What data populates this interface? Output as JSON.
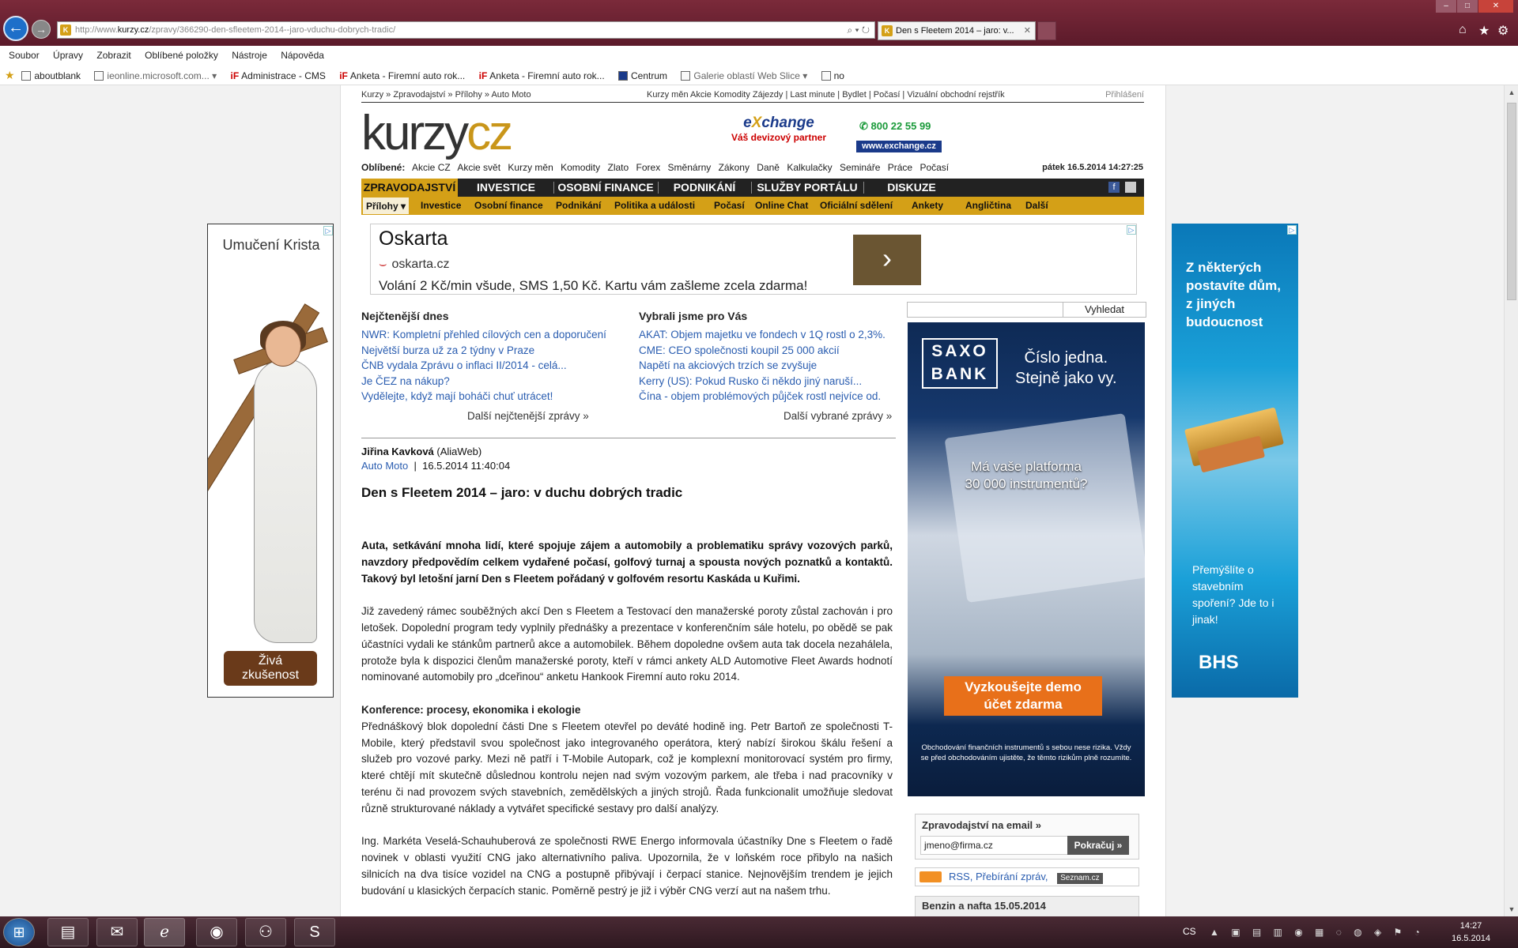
{
  "browser": {
    "url_prefix": "http://www.",
    "url_domain": "kurzy.cz",
    "url_path": "/zpravy/366290-den-sfleetem-2014--jaro-vduchu-dobrych-tradic/",
    "tab_title": "Den s Fleetem 2014 – jaro: v...",
    "tab_close": "✕",
    "favicon": "K",
    "back": "←",
    "forward": "→",
    "addr_icons": "⌕ ▾ ↻",
    "win_min": "–",
    "win_max": "□",
    "win_close": "✕",
    "home": "⌂",
    "star": "★",
    "gear": "⚙"
  },
  "menubar": [
    "Soubor",
    "Úpravy",
    "Zobrazit",
    "Oblíbené položky",
    "Nástroje",
    "Nápověda"
  ],
  "favorites": {
    "star": "★",
    "items": [
      "aboutblank",
      "ieonline.microsoft.com... ▾",
      "Administrace - CMS",
      "Anketa - Firemní auto rok...",
      "Anketa - Firemní auto rok...",
      "Centrum",
      "Galerie oblastí Web Slice ▾",
      "no"
    ]
  },
  "site": {
    "breadcrumb": "Kurzy » Zpravodajství » Přílohy » Auto Moto",
    "toplinks": "Kurzy měn Akcie Komodity Zájezdy | Last minute | Bydlet | Počasí | Vizuální obchodní rejstřík",
    "login": "Přihlášení",
    "logo_k": "kurzy",
    "logo_cz": "cz",
    "exchange_e": "e",
    "exchange_x": "X",
    "exchange_rest": "change",
    "exchange_sub": "Váš devizový partner",
    "phone": "✆ 800 22 55 99",
    "exchange_url": "www.exchange.cz",
    "oblibene_label": "Oblíbené:",
    "oblibene": [
      "Akcie CZ",
      "Akcie svět",
      "Kurzy měn",
      "Komodity",
      "Zlato",
      "Forex",
      "Směnárny",
      "Zákony",
      "Daně",
      "Kalkulačky",
      "Semináře",
      "Práce",
      "Počasí"
    ],
    "datetime": "pátek 16.5.2014 14:27:25",
    "mainnav": [
      "ZPRAVODAJSTVÍ",
      "INVESTICE",
      "OSOBNÍ FINANCE",
      "PODNIKÁNÍ",
      "SLUŽBY PORTÁLU",
      "DISKUZE"
    ],
    "fb": "f",
    "subnav": [
      "Přílohy ▾",
      "Investice",
      "Osobní finance",
      "Podnikání",
      "Politika a události",
      "Počasí",
      "Online Chat",
      "Oficiální sdělení",
      "Ankety",
      "Angličtina",
      "Další"
    ]
  },
  "ad_top": {
    "title": "Oskarta",
    "url_mark": "⌣",
    "url": "oskarta.cz",
    "desc": "Volání 2 Kč/min všude, SMS 1,50 Kč. Kartu vám zašleme zcela zdarma!",
    "arrow": "›",
    "adchoice": "▷"
  },
  "latest": {
    "heading": "Nejčtenější dnes",
    "items": [
      "NWR: Kompletní přehled cílových cen a doporučení",
      "Největší burza už za 2 týdny v Praze",
      "ČNB vydala Zprávu o inflaci II/2014 - celá...",
      "Je ČEZ na nákup?",
      "Vydělejte, když mají boháči chuť utrácet!"
    ],
    "more": "Další nejčtenější zprávy »"
  },
  "picked": {
    "heading": "Vybrali jsme pro Vás",
    "items": [
      "AKAT: Objem majetku ve fondech v 1Q rostl o 2,3%.",
      "CME: CEO společnosti koupil 25 000 akcií",
      "Napětí na akciových trzích se zvyšuje",
      "Kerry (US): Pokud Rusko či někdo jiný naruší...",
      "Čína - objem problémových půjček rostl nejvíce od."
    ],
    "more": "Další vybrané zprávy »"
  },
  "article": {
    "author": "Jiřina Kavková",
    "source": "(AliaWeb)",
    "category": "Auto Moto",
    "date": "16.5.2014 11:40:04",
    "title": "Den s Fleetem 2014 – jaro: v duchu dobrých tradic",
    "perex": "Auta, setkávání mnoha lidí, které spojuje zájem a automobily a problematiku správy vozových parků, navzdory předpovědím celkem vydařené počasí, golfový turnaj a spousta nových poznatků a kontaktů. Takový byl letošní jarní Den s Fleetem pořádaný v golfovém resortu Kaskáda u Kuřimi.",
    "p1": "Již zavedený rámec souběžných akcí Den s Fleetem a Testovací den manažerské poroty zůstal zachován i pro letošek. Dopolední program tedy vyplnily přednášky a prezentace v konferenčním sále hotelu, po obědě se pak účastníci vydali ke stánkům partnerů akce a automobilek. Během dopoledne ovšem auta tak docela nezahálela, protože byla k dispozici členům manažerské poroty, kteří v rámci ankety ALD Automotive Fleet Awards hodnotí nominované automobily pro „dceřinou“ anketu Hankook Firemní auto roku 2014.",
    "subhead": "Konference: procesy, ekonomika i ekologie",
    "p2": "Přednáškový blok dopolední části Dne s Fleetem otevřel po deváté hodině ing. Petr Bartoň ze společnosti T-Mobile, který představil svou společnost jako integrovaného operátora, který nabízí širokou škálu řešení a služeb pro vozové parky. Mezi ně patří i T-Mobile Autopark, což je komplexní monitorovací systém pro firmy, které chtějí mít skutečně důslednou kontrolu nejen nad svým vozovým parkem, ale třeba i nad pracovníky v terénu či nad provozem svých stavebních, zemědělských a jiných strojů. Řada funkcionalit umožňuje sledovat různě strukturované náklady a vytvářet specifické sestavy pro další analýzy.",
    "p3": "Ing. Markéta Veselá-Schauhuberová ze společnosti RWE Energo informovala účastníky Dne s Fleetem o řadě novinek v oblasti využití CNG jako alternativního paliva. Upozornila, že v loňském roce přibylo na našich silnicích na dva tisíce vozidel na CNG a postupně přibývají i čerpací stanice. Nejnovějším trendem je jejich budování u klasických čerpacích stanic. Poměrně pestrý je již i výběr CNG verzí aut na našem trhu."
  },
  "search": {
    "button": "Vyhledat"
  },
  "saxo": {
    "logo_line1": "SAXO",
    "logo_line2": "BANK",
    "slogan_line1": "Číslo jedna.",
    "slogan_line2": "Stejně jako vy.",
    "question_line1": "Má vaše platforma",
    "question_line2": "30 000 instrumentů?",
    "cta_line1": "Vyzkoušejte demo",
    "cta_line2": "účet zdarma",
    "disclaimer": "Obchodování finančních instrumentů s sebou nese rizika. Vždy se před obchodováním ujistěte, že těmto rizikům plně rozumíte."
  },
  "newsletter": {
    "heading": "Zpravodajství na email »",
    "email": "jmeno@firma.cz",
    "button": "Pokračuj »"
  },
  "rss": {
    "label": "RSS, Přebírání zpráv,",
    "seznam": "Seznam.cz"
  },
  "benzin": {
    "heading": "Benzin a nafta 15.05.2014"
  },
  "ad_left": {
    "heading": "Umučení Krista",
    "cta_line1": "Živá",
    "cta_line2": "zkušenost"
  },
  "ad_right": {
    "heading": "Z některých postavíte dům, z jiných budoucnost",
    "text": "Přemýšlíte o stavebním spoření? Jde to i jinak!",
    "brand": "BHS"
  },
  "taskbar": {
    "lang": "CS",
    "time": "14:27",
    "date": "16.5.2014",
    "start": "⊞",
    "tray": "▲ ▣ ▤ ▥ ◉ ▦ ◌ ◍ ◈ ⚑ ◔"
  }
}
